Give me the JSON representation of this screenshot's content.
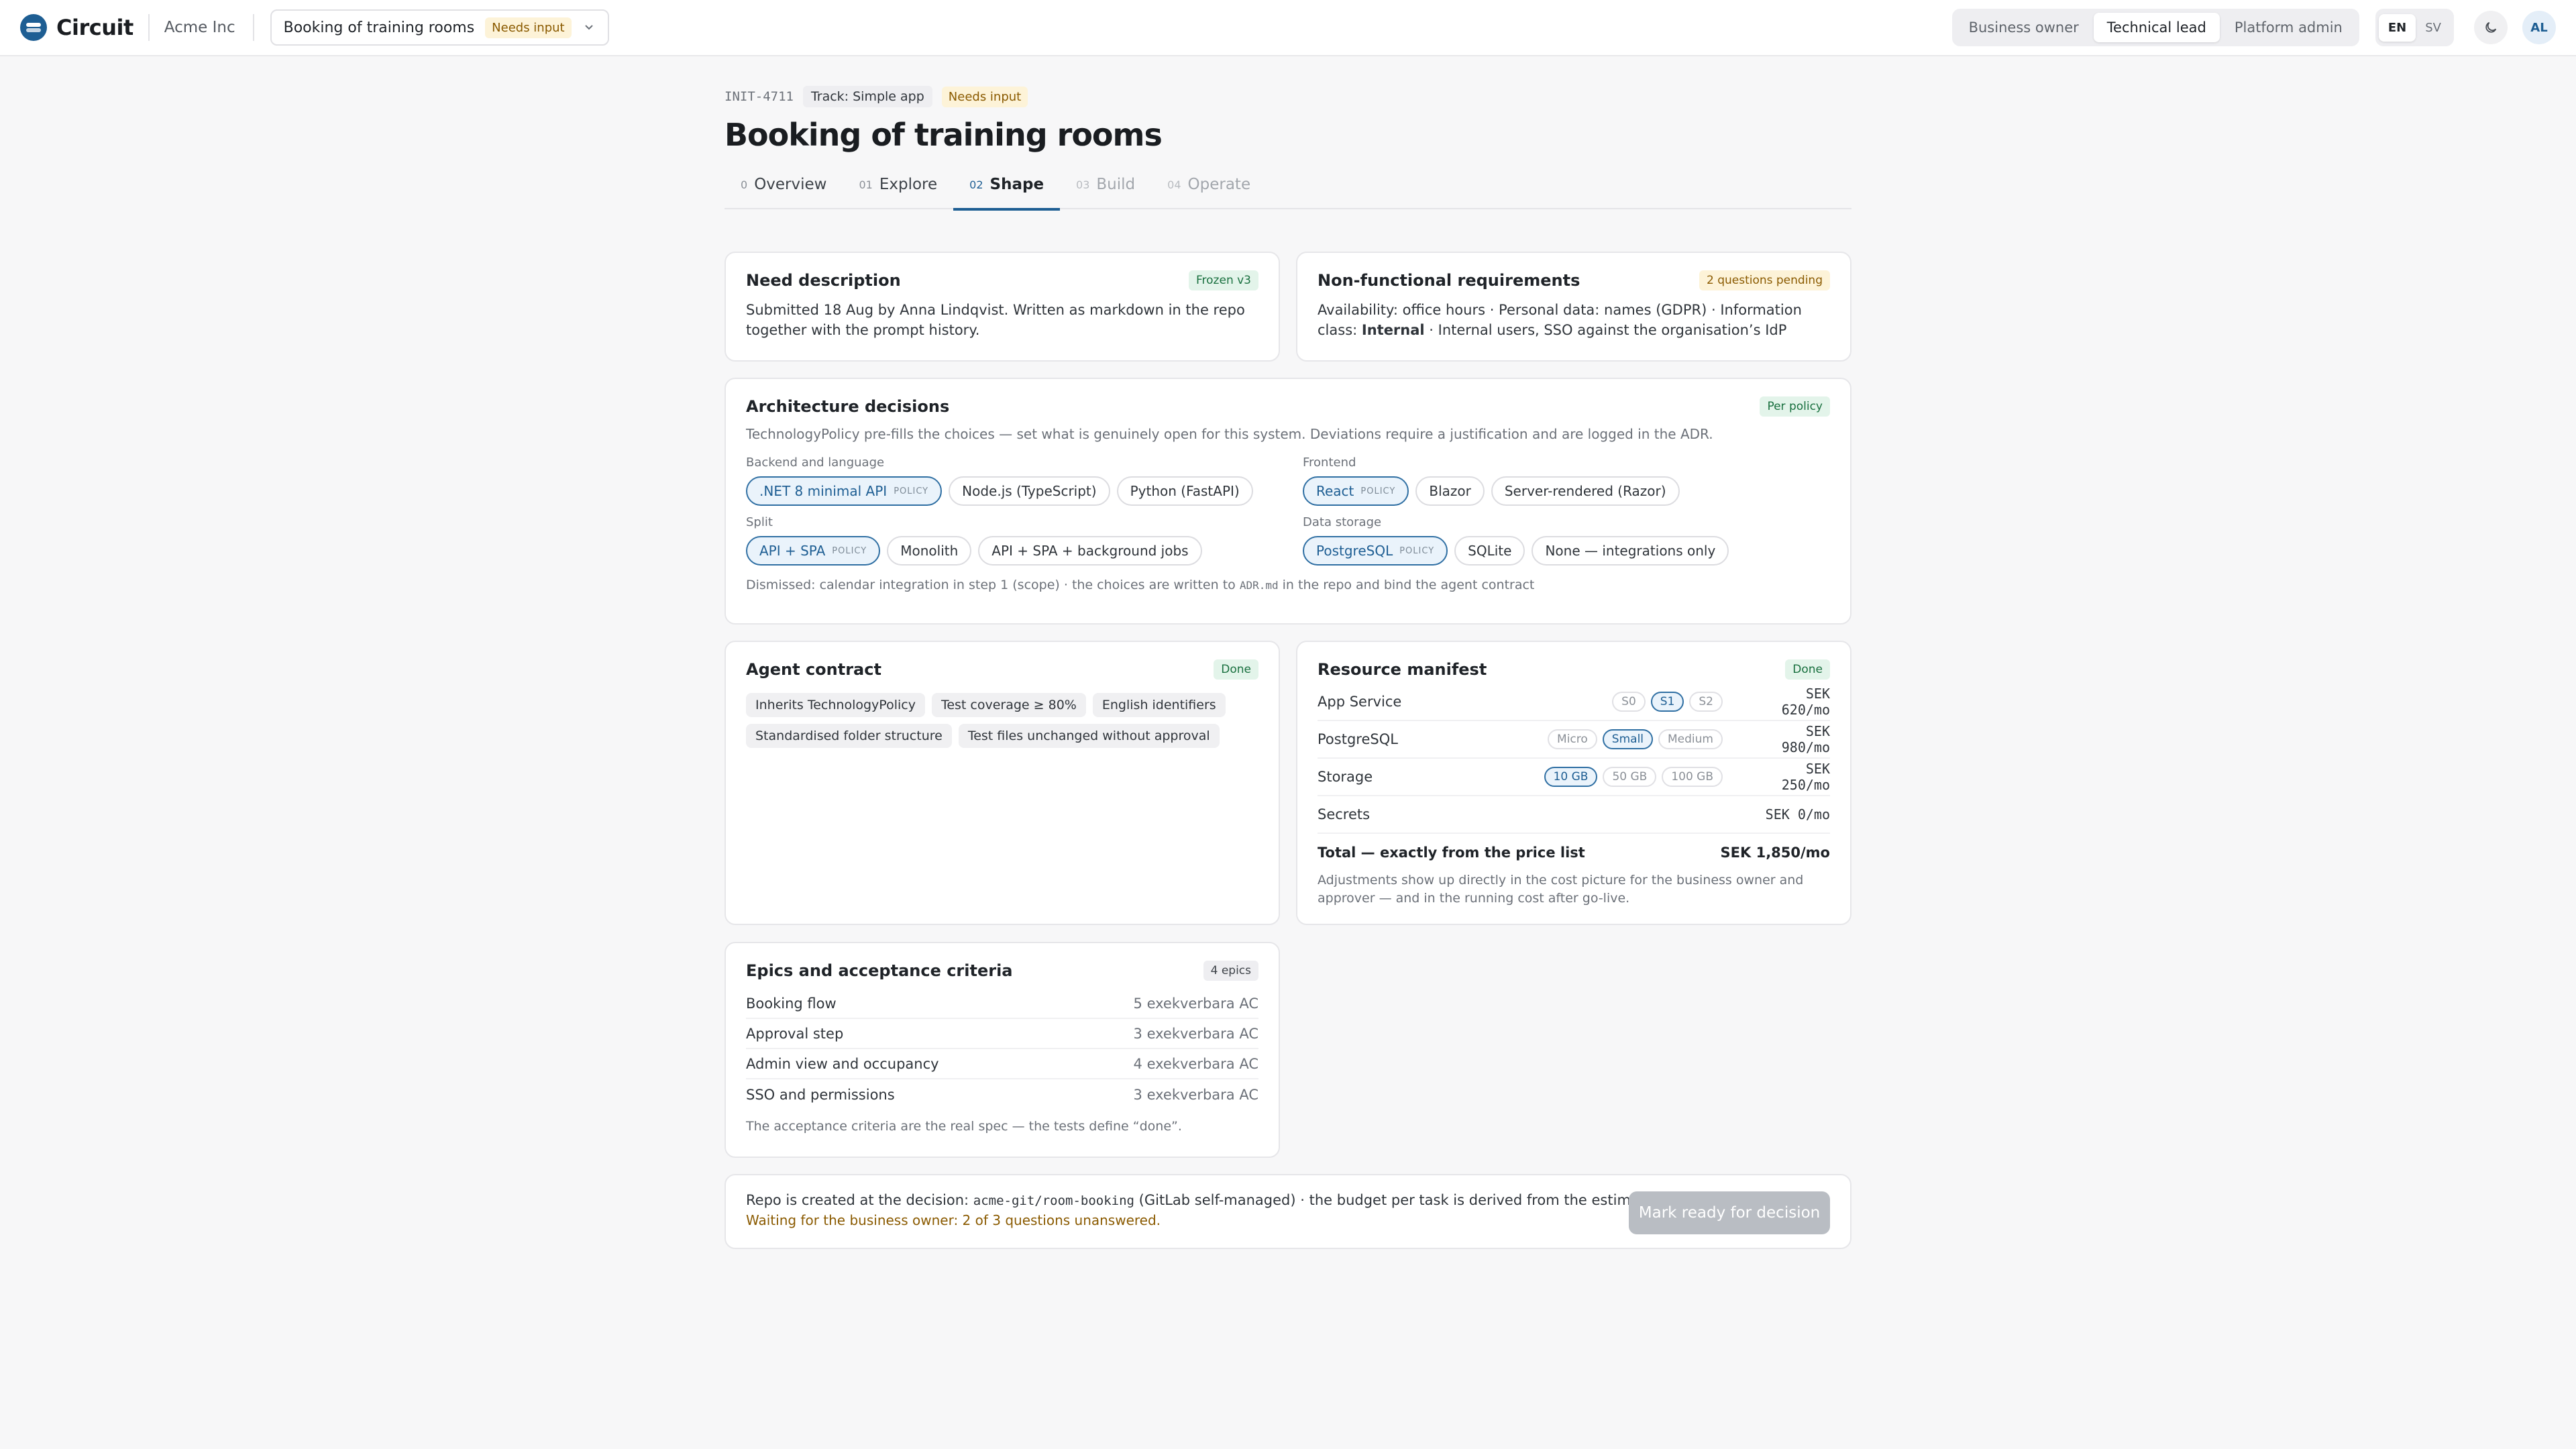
{
  "app": {
    "name": "Circuit",
    "org": "Acme Inc"
  },
  "initiative_picker": {
    "title": "Booking of training rooms",
    "status": "Needs input"
  },
  "roles": [
    "Business owner",
    "Technical lead",
    "Platform admin"
  ],
  "active_role": "Technical lead",
  "languages": [
    "EN",
    "SV"
  ],
  "user_initials": "AL",
  "header": {
    "id": "INIT-4711",
    "track": "Track: Simple app",
    "status": "Needs input",
    "title": "Booking of training rooms"
  },
  "tabs": [
    {
      "num": "0",
      "label": "Overview"
    },
    {
      "num": "01",
      "label": "Explore"
    },
    {
      "num": "02",
      "label": "Shape"
    },
    {
      "num": "03",
      "label": "Build"
    },
    {
      "num": "04",
      "label": "Operate"
    }
  ],
  "need": {
    "title": "Need description",
    "badge": "Frozen v3",
    "text": "Submitted 18 Aug by Anna Lindqvist. Written as markdown in the repo together with the prompt history."
  },
  "nfr": {
    "title": "Non-functional requirements",
    "badge": "2 questions pending",
    "text_a": "Availability: office hours · Personal data: names (GDPR) · Information class: ",
    "text_strong": "Internal",
    "text_b": " · Internal users, SSO against the organisation’s IdP"
  },
  "architecture": {
    "title": "Architecture decisions",
    "badge": "Per policy",
    "intro": "TechnologyPolicy pre-fills the choices — set what is genuinely open for this system. Deviations require a justification and are logged in the ADR.",
    "policy_tag": "POLICY",
    "groups": [
      {
        "label": "Backend and language",
        "options": [
          ".NET 8 minimal API",
          "Node.js (TypeScript)",
          "Python (FastAPI)"
        ]
      },
      {
        "label": "Frontend",
        "options": [
          "React",
          "Blazor",
          "Server-rendered (Razor)"
        ]
      },
      {
        "label": "Split",
        "options": [
          "API + SPA",
          "Monolith",
          "API + SPA + background jobs"
        ]
      },
      {
        "label": "Data storage",
        "options": [
          "PostgreSQL",
          "SQLite",
          "None — integrations only"
        ]
      }
    ],
    "footnote_a": "Dismissed: calendar integration in step 1 (scope) · the choices are written to ",
    "footnote_code": "ADR.md",
    "footnote_b": " in the repo and bind the agent contract"
  },
  "agent_contract": {
    "title": "Agent contract",
    "badge": "Done",
    "tags": [
      "Inherits TechnologyPolicy",
      "Test coverage ≥ 80%",
      "English identifiers",
      "Standardised folder structure",
      "Test files unchanged without approval"
    ]
  },
  "resources": {
    "title": "Resource manifest",
    "badge": "Done",
    "rows": [
      {
        "name": "App Service",
        "sizes": [
          "S0",
          "S1",
          "S2"
        ],
        "selected": 1,
        "cost": "SEK 620/mo"
      },
      {
        "name": "PostgreSQL",
        "sizes": [
          "Micro",
          "Small",
          "Medium"
        ],
        "selected": 1,
        "cost": "SEK 980/mo"
      },
      {
        "name": "Storage",
        "sizes": [
          "10 GB",
          "50 GB",
          "100 GB"
        ],
        "selected": 0,
        "cost": "SEK 250/mo"
      },
      {
        "name": "Secrets",
        "sizes": [],
        "selected": -1,
        "cost": "SEK 0/mo"
      }
    ],
    "total_label": "Total — exactly from the price list",
    "total_value": "SEK 1,850/mo",
    "note": "Adjustments show up directly in the cost picture for the business owner and approver — and in the running cost after go-live."
  },
  "epics": {
    "title": "Epics and acceptance criteria",
    "badge": "4 epics",
    "rows": [
      {
        "name": "Booking flow",
        "ac": "5 exekverbara AC"
      },
      {
        "name": "Approval step",
        "ac": "3 exekverbara AC"
      },
      {
        "name": "Admin view and occupancy",
        "ac": "4 exekverbara AC"
      },
      {
        "name": "SSO and permissions",
        "ac": "3 exekverbara AC"
      }
    ],
    "note": "The acceptance criteria are the real spec — the tests define “done”."
  },
  "footer": {
    "text_a": "Repo is created at the decision: ",
    "repo": "acme-git/room-booking",
    "text_b": " (GitLab self-managed) · the budget per task is derived from the estimate",
    "waiting": "Waiting for the business owner: 2 of 3 questions unanswered.",
    "button": "Mark ready for decision"
  },
  "colors": {
    "accent": "#1e5e93",
    "warning": "#8a5a00",
    "success": "#19703f",
    "disabled": "#b9bdc3"
  }
}
